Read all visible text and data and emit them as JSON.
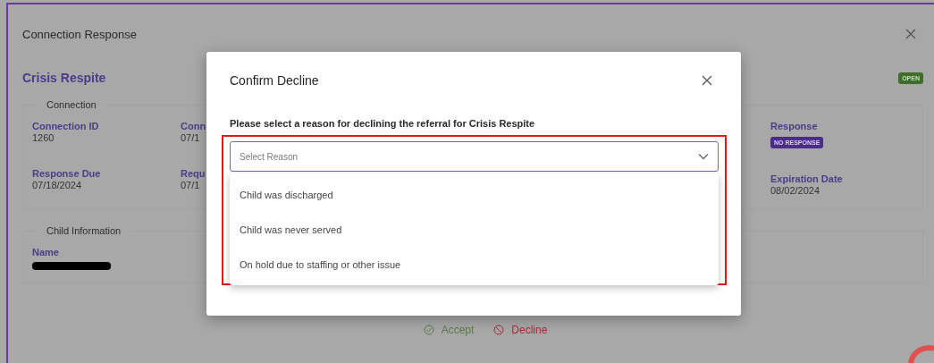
{
  "page": {
    "title": "Connection Response",
    "program": "Crisis Respite",
    "status_badge": "OPEN"
  },
  "connection": {
    "legend": "Connection",
    "columns": [
      {
        "fields": [
          {
            "label": "Connection ID",
            "kind": "text",
            "value": "1260"
          },
          {
            "label": "Response Due",
            "kind": "text",
            "value": "07/18/2024"
          }
        ]
      },
      {
        "fields": [
          {
            "label": "Conn",
            "kind": "text",
            "value": "07/1"
          },
          {
            "label": "Requ",
            "kind": "text",
            "value": "07/1"
          }
        ]
      },
      {
        "fields": [
          {
            "label": "Response",
            "kind": "badge",
            "value": "NO RESPONSE"
          },
          {
            "label": "Expiration Date",
            "kind": "text",
            "value": "08/02/2024"
          }
        ]
      }
    ]
  },
  "child_information": {
    "legend": "Child Information",
    "fields": [
      {
        "label": "Name",
        "redacted": true
      }
    ]
  },
  "actions": [
    {
      "label": "Accept",
      "kind": "accept"
    },
    {
      "label": "Decline",
      "kind": "decline"
    }
  ],
  "dialog": {
    "title": "Confirm Decline",
    "prompt": "Please select a reason for declining the referral for Crisis Respite",
    "select": {
      "placeholder": "Select Reason",
      "expanded": true
    },
    "options": [
      {
        "label": "Child was discharged"
      },
      {
        "label": "Child was never served"
      },
      {
        "label": "On hold due to staffing or other issue"
      }
    ]
  }
}
